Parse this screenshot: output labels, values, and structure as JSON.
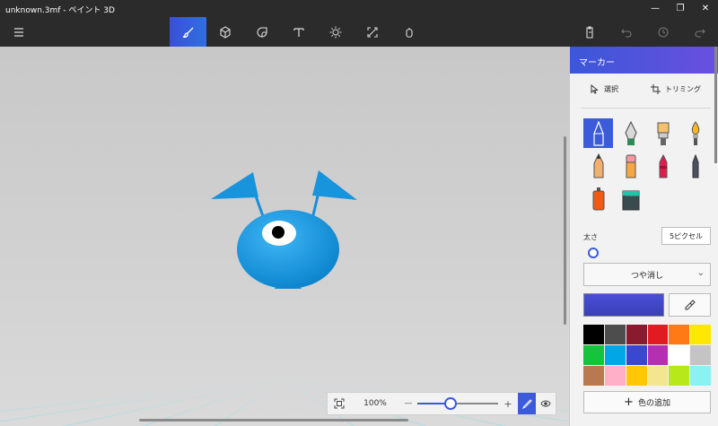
{
  "window": {
    "title": "unknown.3mf - ペイント 3D",
    "minimize": "—",
    "maximize": "❐",
    "close": "✕"
  },
  "toolbar": {
    "tools": [
      {
        "name": "brushes-tool",
        "icon": "brush-icon",
        "active": true
      },
      {
        "name": "3d-shapes-tool",
        "icon": "cube-icon",
        "active": false
      },
      {
        "name": "stickers-tool",
        "icon": "sticker-icon",
        "active": false
      },
      {
        "name": "text-tool",
        "icon": "text-icon",
        "active": false
      },
      {
        "name": "effects-tool",
        "icon": "sun-icon",
        "active": false
      },
      {
        "name": "canvas-tool",
        "icon": "resize-icon",
        "active": false
      },
      {
        "name": "3d-library-tool",
        "icon": "library-icon",
        "active": false
      }
    ]
  },
  "zoom": {
    "value": "100%",
    "minus": "—",
    "plus": "+",
    "level": 0.33
  },
  "panel": {
    "title": "マーカー",
    "select_label": "選択",
    "crop_label": "トリミング",
    "thickness_label": "太さ",
    "thickness_value": "5ピクセル",
    "finish_value": "つや消し",
    "add_color_label": "色の追加",
    "current_color": "#4347cc",
    "brushes": [
      {
        "name": "marker",
        "active": true
      },
      {
        "name": "calligraphy-pen"
      },
      {
        "name": "oil-brush"
      },
      {
        "name": "watercolor"
      },
      {
        "name": "pencil"
      },
      {
        "name": "eraser"
      },
      {
        "name": "crayon"
      },
      {
        "name": "pixel-pen"
      },
      {
        "name": "spray-can"
      },
      {
        "name": "fill"
      }
    ],
    "swatches": [
      "#000000",
      "#4d4d4d",
      "#8a1b2e",
      "#e21b23",
      "#ff7a14",
      "#ffe800",
      "#15c33c",
      "#00a6e6",
      "#3a47d0",
      "#b52fb3",
      "#ffffff",
      "#c4c4c4",
      "#b87950",
      "#ffb0c8",
      "#ffc708",
      "#f3e690",
      "#b7e81a",
      "#8af2f2"
    ]
  }
}
